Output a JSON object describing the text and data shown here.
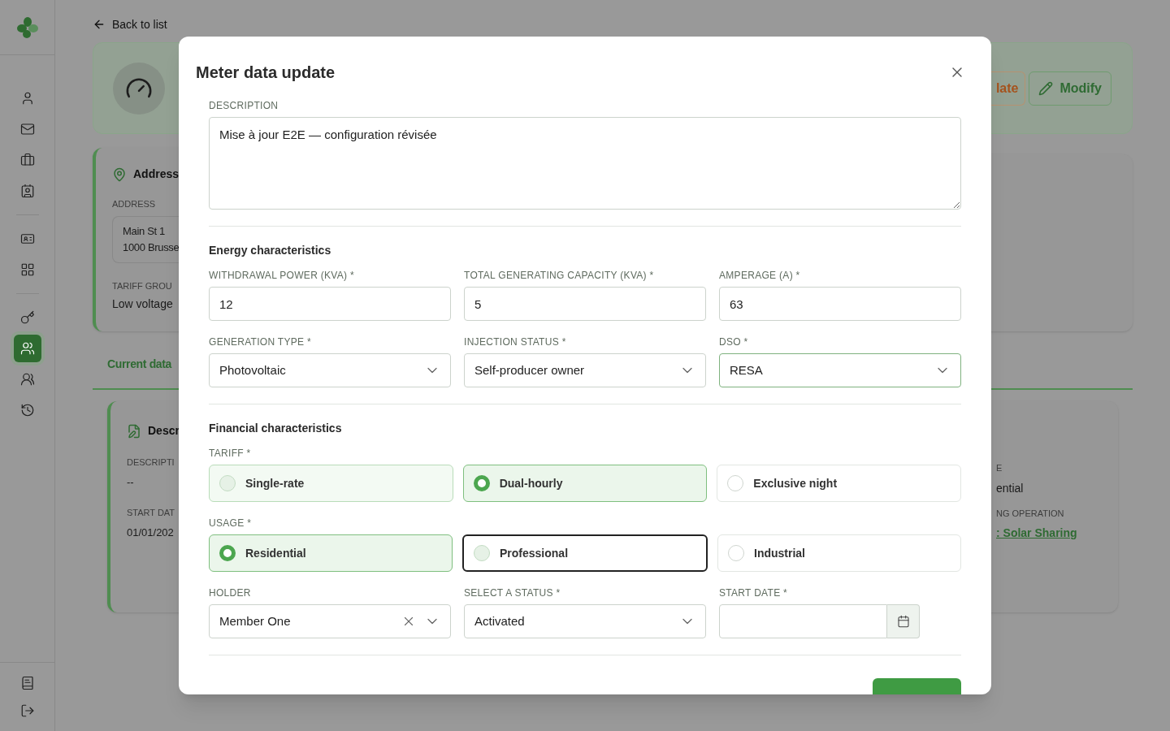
{
  "sidebar": {
    "items": [
      {
        "selected": false
      },
      {
        "selected": false
      },
      {
        "selected": false
      },
      {
        "selected": false
      },
      {
        "selected": false
      },
      {
        "selected": false
      },
      {
        "selected": false
      },
      {
        "selected": true
      },
      {
        "selected": false
      },
      {
        "selected": false
      },
      {
        "selected": false
      },
      {
        "selected": false
      }
    ]
  },
  "back_link": "Back to list",
  "header": {
    "buttons": [
      {
        "label": "late",
        "kind": "update"
      },
      {
        "label": "Modify",
        "kind": "modify"
      }
    ]
  },
  "address_card": {
    "title": "Address",
    "fields": [
      {
        "label": "ADDRESS",
        "lines": [
          "Main St 1",
          "1000 Brusse"
        ]
      },
      {
        "label": "TARIFF GROU",
        "value": "Low voltage"
      }
    ]
  },
  "tabs": [
    {
      "label": "Current data",
      "selected": true
    }
  ],
  "description_card": {
    "title": "Descr",
    "left_fields": [
      {
        "label": "DESCRIPTI",
        "value": "--"
      },
      {
        "label": "START DAT",
        "value": "01/01/202"
      }
    ],
    "right_fields": [
      {
        "label": "E",
        "value": "ential",
        "kind": "text"
      },
      {
        "label": "NG OPERATION",
        "value": ": Solar Sharing",
        "kind": "link"
      }
    ]
  },
  "modal": {
    "title": "Meter data update",
    "description": {
      "label": "DESCRIPTION",
      "value": "Mise à jour E2E — configuration révisée"
    },
    "energy": {
      "title": "Energy characteristics",
      "fields": [
        {
          "label": "WITHDRAWAL POWER (KVA) *",
          "kind": "text",
          "value": "12"
        },
        {
          "label": "TOTAL GENERATING CAPACITY (KVA) *",
          "kind": "text",
          "value": "5"
        },
        {
          "label": "AMPERAGE (A) *",
          "kind": "text",
          "value": "63"
        },
        {
          "label": "GENERATION TYPE *",
          "kind": "select",
          "value": "Photovoltaic"
        },
        {
          "label": "INJECTION STATUS *",
          "kind": "select",
          "value": "Self-producer owner"
        },
        {
          "label": "DSO *",
          "kind": "select",
          "value": "RESA",
          "focused": true
        }
      ]
    },
    "financial": {
      "title": "Financial characteristics",
      "groups": [
        {
          "label": "TARIFF *",
          "options": [
            {
              "label": "Single-rate",
              "selected": false,
              "hovered": true,
              "focused": false
            },
            {
              "label": "Dual-hourly",
              "selected": true,
              "hovered": false,
              "focused": false
            },
            {
              "label": "Exclusive night",
              "selected": false,
              "hovered": false,
              "focused": false
            }
          ]
        },
        {
          "label": "USAGE *",
          "options": [
            {
              "label": "Residential",
              "selected": true,
              "hovered": false,
              "focused": false
            },
            {
              "label": "Professional",
              "selected": false,
              "hovered": false,
              "focused": true
            },
            {
              "label": "Industrial",
              "selected": false,
              "hovered": false,
              "focused": false
            }
          ]
        }
      ],
      "fields": [
        {
          "label": "HOLDER",
          "kind": "select",
          "value": "Member One",
          "clearable": true
        },
        {
          "label": "SELECT A STATUS *",
          "kind": "select",
          "value": "Activated"
        },
        {
          "label": "START DATE *",
          "kind": "date"
        }
      ]
    }
  }
}
